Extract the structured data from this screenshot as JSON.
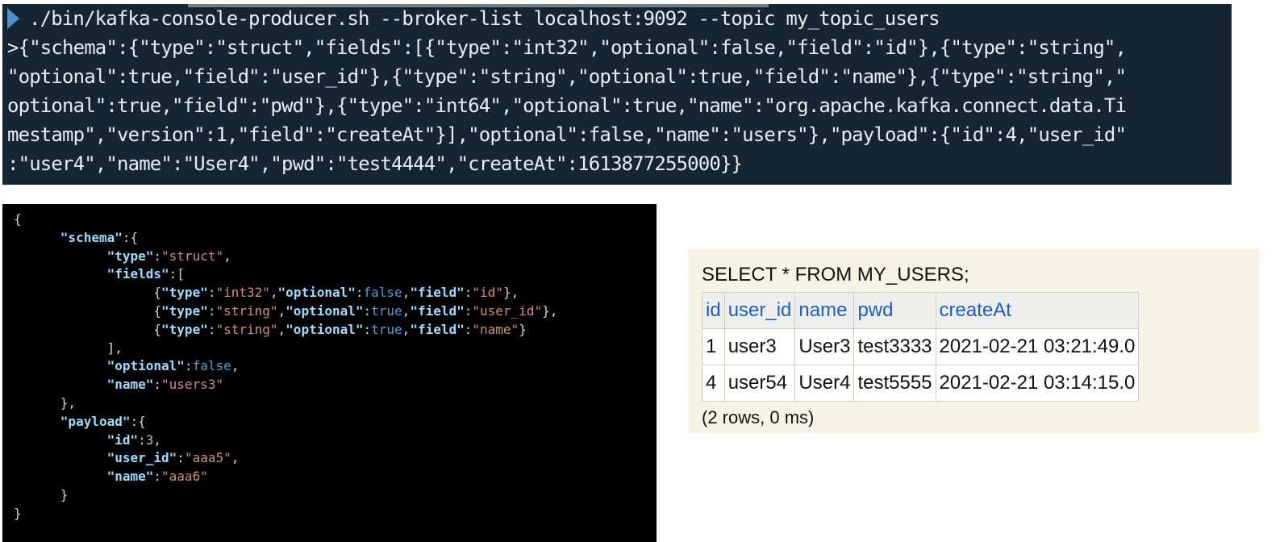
{
  "terminal": {
    "lines": [
      "./bin/kafka-console-producer.sh --broker-list localhost:9092 --topic my_topic_users",
      ">{\"schema\":{\"type\":\"struct\",\"fields\":[{\"type\":\"int32\",\"optional\":false,\"field\":\"id\"},{\"type\":\"string\",",
      "\"optional\":true,\"field\":\"user_id\"},{\"type\":\"string\",\"optional\":true,\"field\":\"name\"},{\"type\":\"string\",\"",
      "optional\":true,\"field\":\"pwd\"},{\"type\":\"int64\",\"optional\":true,\"name\":\"org.apache.kafka.connect.data.Ti",
      "mestamp\",\"version\":1,\"field\":\"createAt\"}],\"optional\":false,\"name\":\"users\"},\"payload\":{\"id\":4,\"user_id\"",
      ":\"user4\",\"name\":\"User4\",\"pwd\":\"test4444\",\"createAt\":1613877255000}}"
    ],
    "prompt_icon": "chevron-right-icon",
    "background": "#152532"
  },
  "json_view": {
    "lines": [
      [
        {
          "t": "p",
          "v": "{"
        }
      ],
      [
        {
          "t": "p",
          "v": "      "
        },
        {
          "t": "k",
          "v": "\"schema\""
        },
        {
          "t": "p",
          "v": ":{"
        }
      ],
      [
        {
          "t": "p",
          "v": "            "
        },
        {
          "t": "k",
          "v": "\"type\""
        },
        {
          "t": "p",
          "v": ":"
        },
        {
          "t": "s",
          "v": "\"struct\""
        },
        {
          "t": "p",
          "v": ","
        }
      ],
      [
        {
          "t": "p",
          "v": "            "
        },
        {
          "t": "k",
          "v": "\"fields\""
        },
        {
          "t": "p",
          "v": ":["
        }
      ],
      [
        {
          "t": "p",
          "v": "                  {"
        },
        {
          "t": "k",
          "v": "\"type\""
        },
        {
          "t": "p",
          "v": ":"
        },
        {
          "t": "s",
          "v": "\"int32\""
        },
        {
          "t": "p",
          "v": ","
        },
        {
          "t": "k",
          "v": "\"optional\""
        },
        {
          "t": "p",
          "v": ":"
        },
        {
          "t": "b",
          "v": "false"
        },
        {
          "t": "p",
          "v": ","
        },
        {
          "t": "k",
          "v": "\"field\""
        },
        {
          "t": "p",
          "v": ":"
        },
        {
          "t": "s",
          "v": "\"id\""
        },
        {
          "t": "p",
          "v": "},"
        }
      ],
      [
        {
          "t": "p",
          "v": "                  {"
        },
        {
          "t": "k",
          "v": "\"type\""
        },
        {
          "t": "p",
          "v": ":"
        },
        {
          "t": "s",
          "v": "\"string\""
        },
        {
          "t": "p",
          "v": ","
        },
        {
          "t": "k",
          "v": "\"optional\""
        },
        {
          "t": "p",
          "v": ":"
        },
        {
          "t": "b",
          "v": "true"
        },
        {
          "t": "p",
          "v": ","
        },
        {
          "t": "k",
          "v": "\"field\""
        },
        {
          "t": "p",
          "v": ":"
        },
        {
          "t": "s",
          "v": "\"user_id\""
        },
        {
          "t": "p",
          "v": "},"
        }
      ],
      [
        {
          "t": "p",
          "v": "                  {"
        },
        {
          "t": "k",
          "v": "\"type\""
        },
        {
          "t": "p",
          "v": ":"
        },
        {
          "t": "s",
          "v": "\"string\""
        },
        {
          "t": "p",
          "v": ","
        },
        {
          "t": "k",
          "v": "\"optional\""
        },
        {
          "t": "p",
          "v": ":"
        },
        {
          "t": "b",
          "v": "true"
        },
        {
          "t": "p",
          "v": ","
        },
        {
          "t": "k",
          "v": "\"field\""
        },
        {
          "t": "p",
          "v": ":"
        },
        {
          "t": "s",
          "v": "\"name\""
        },
        {
          "t": "p",
          "v": "}"
        }
      ],
      [
        {
          "t": "p",
          "v": "            ],"
        }
      ],
      [
        {
          "t": "p",
          "v": "            "
        },
        {
          "t": "k",
          "v": "\"optional\""
        },
        {
          "t": "p",
          "v": ":"
        },
        {
          "t": "b",
          "v": "false"
        },
        {
          "t": "p",
          "v": ","
        }
      ],
      [
        {
          "t": "p",
          "v": "            "
        },
        {
          "t": "k",
          "v": "\"name\""
        },
        {
          "t": "p",
          "v": ":"
        },
        {
          "t": "s",
          "v": "\"users3\""
        }
      ],
      [
        {
          "t": "p",
          "v": "      },"
        }
      ],
      [
        {
          "t": "p",
          "v": "      "
        },
        {
          "t": "k",
          "v": "\"payload\""
        },
        {
          "t": "p",
          "v": ":{"
        }
      ],
      [
        {
          "t": "p",
          "v": "            "
        },
        {
          "t": "k",
          "v": "\"id\""
        },
        {
          "t": "p",
          "v": ":"
        },
        {
          "t": "n",
          "v": "3"
        },
        {
          "t": "p",
          "v": ","
        }
      ],
      [
        {
          "t": "p",
          "v": "            "
        },
        {
          "t": "k",
          "v": "\"user_id\""
        },
        {
          "t": "p",
          "v": ":"
        },
        {
          "t": "s",
          "v": "\"aaa5\""
        },
        {
          "t": "p",
          "v": ","
        }
      ],
      [
        {
          "t": "p",
          "v": "            "
        },
        {
          "t": "k",
          "v": "\"name\""
        },
        {
          "t": "p",
          "v": ":"
        },
        {
          "t": "s",
          "v": "\"aaa6\""
        }
      ],
      [
        {
          "t": "p",
          "v": "      }"
        }
      ],
      [
        {
          "t": "p",
          "v": "}"
        }
      ]
    ],
    "colors": {
      "key": "#9cdcfe",
      "string": "#ce9178",
      "boolean": "#569cd6",
      "number": "#b5cea8",
      "punct": "#d4d4d4"
    }
  },
  "sql": {
    "query": "SELECT * FROM MY_USERS;",
    "columns": [
      "id",
      "user_id",
      "name",
      "pwd",
      "createAt"
    ],
    "rows": [
      [
        "1",
        "user3",
        "User3",
        "test3333",
        "2021-02-21 03:21:49.0"
      ],
      [
        "4",
        "user54",
        "User4",
        "test5555",
        "2021-02-21 03:14:15.0"
      ]
    ],
    "footer": "(2 rows, 0 ms)",
    "header_color": "#1a5ccf"
  }
}
